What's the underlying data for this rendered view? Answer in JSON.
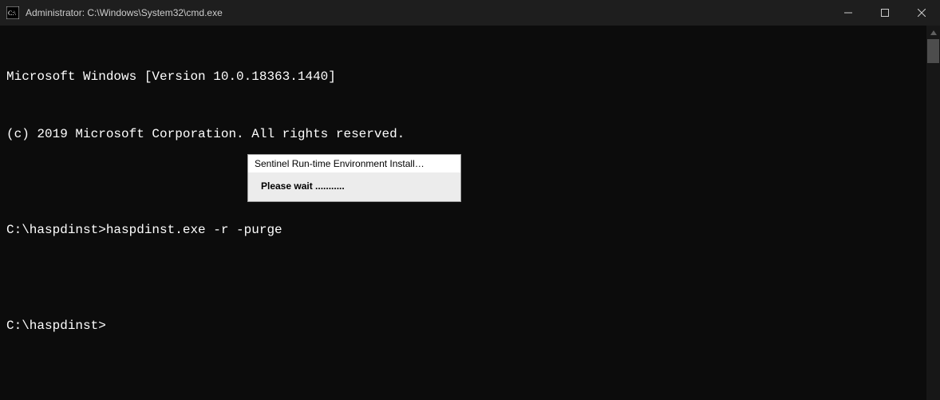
{
  "window": {
    "title": "Administrator: C:\\Windows\\System32\\cmd.exe"
  },
  "terminal": {
    "lines": [
      "Microsoft Windows [Version 10.0.18363.1440]",
      "(c) 2019 Microsoft Corporation. All rights reserved.",
      "",
      "C:\\haspdinst>haspdinst.exe -r -purge",
      "",
      "C:\\haspdinst>"
    ]
  },
  "dialog": {
    "title": "Sentinel Run-time Environment Install…",
    "message": "Please wait ..........."
  }
}
